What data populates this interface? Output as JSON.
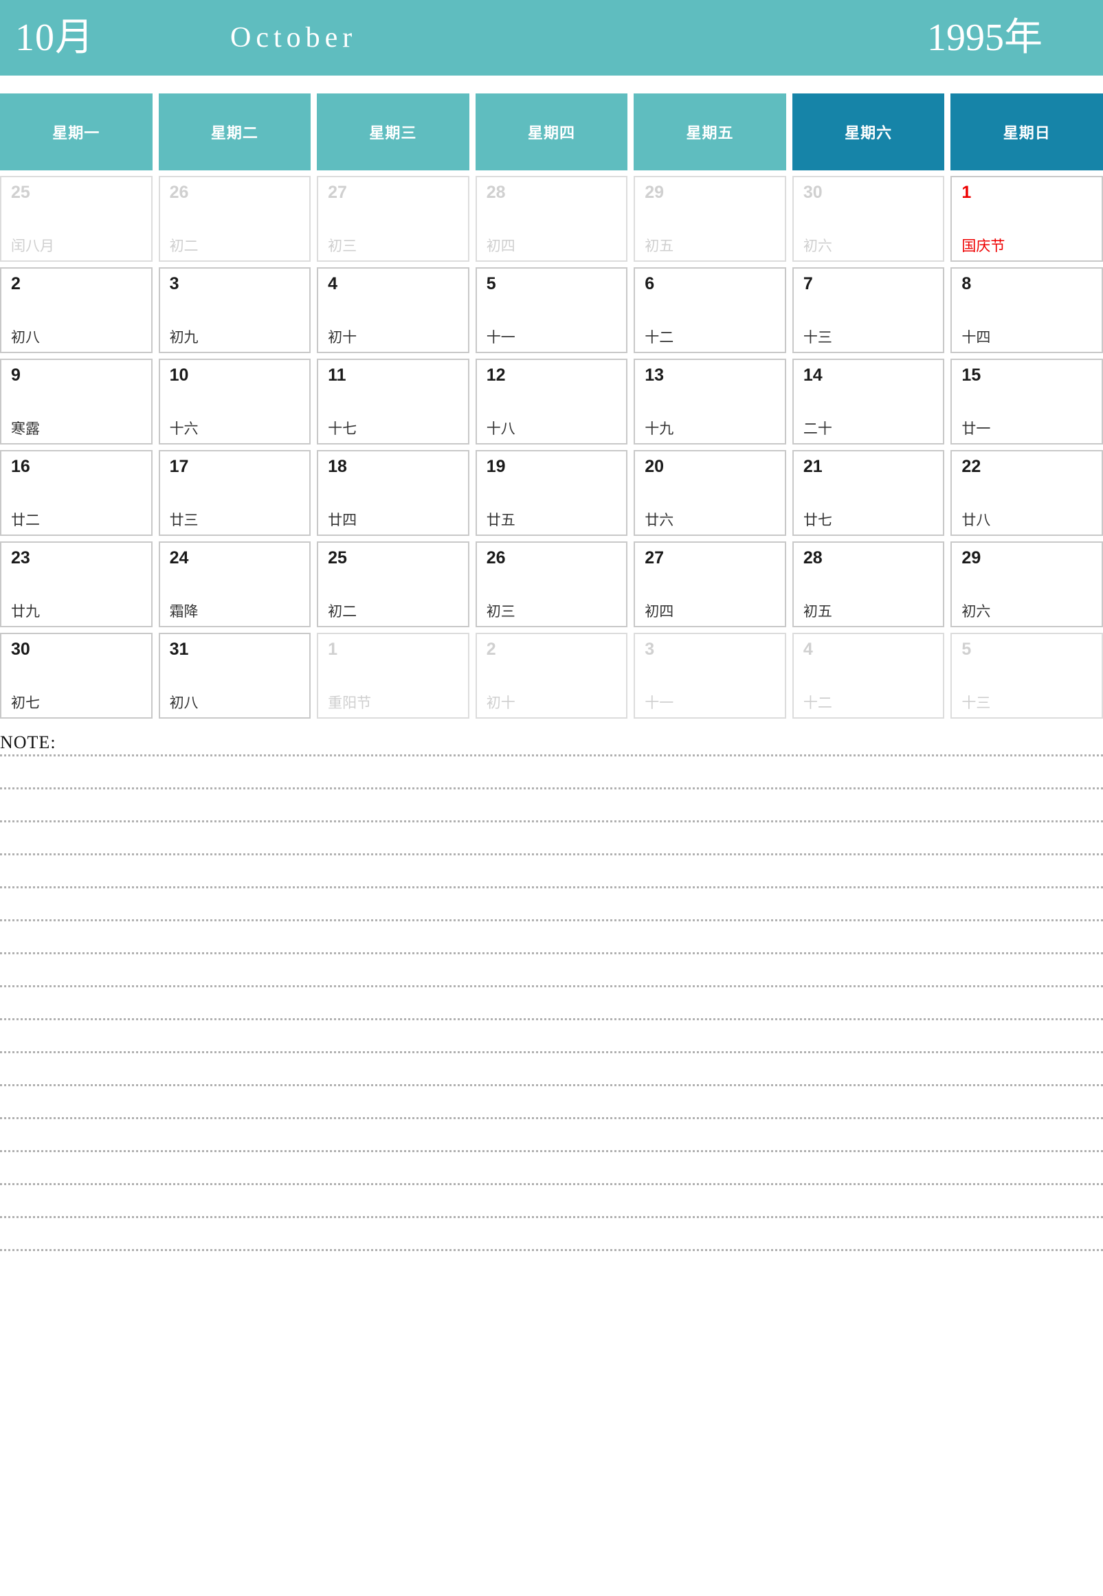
{
  "header": {
    "month_cn": "10月",
    "month_en": "October",
    "year": "1995年",
    "bg_color": "#5fbdbf",
    "text_color": "#ffffff"
  },
  "colors": {
    "accent_teal": "#5fbdbf",
    "accent_blue": "#1684a8",
    "holiday_red": "#ee0000",
    "muted_gray": "#cfcfcf",
    "cell_border": "#c8c8c8"
  },
  "weekdays": [
    {
      "label": "星期一",
      "weekend": false
    },
    {
      "label": "星期二",
      "weekend": false
    },
    {
      "label": "星期三",
      "weekend": false
    },
    {
      "label": "星期四",
      "weekend": false
    },
    {
      "label": "星期五",
      "weekend": false
    },
    {
      "label": "星期六",
      "weekend": true
    },
    {
      "label": "星期日",
      "weekend": true
    }
  ],
  "weeks": [
    [
      {
        "num": "25",
        "lunar": "闰八月",
        "muted": true,
        "holiday": false
      },
      {
        "num": "26",
        "lunar": "初二",
        "muted": true,
        "holiday": false
      },
      {
        "num": "27",
        "lunar": "初三",
        "muted": true,
        "holiday": false
      },
      {
        "num": "28",
        "lunar": "初四",
        "muted": true,
        "holiday": false
      },
      {
        "num": "29",
        "lunar": "初五",
        "muted": true,
        "holiday": false
      },
      {
        "num": "30",
        "lunar": "初六",
        "muted": true,
        "holiday": false
      },
      {
        "num": "1",
        "lunar": "国庆节",
        "muted": false,
        "holiday": true
      }
    ],
    [
      {
        "num": "2",
        "lunar": "初八",
        "muted": false,
        "holiday": false
      },
      {
        "num": "3",
        "lunar": "初九",
        "muted": false,
        "holiday": false
      },
      {
        "num": "4",
        "lunar": "初十",
        "muted": false,
        "holiday": false
      },
      {
        "num": "5",
        "lunar": "十一",
        "muted": false,
        "holiday": false
      },
      {
        "num": "6",
        "lunar": "十二",
        "muted": false,
        "holiday": false
      },
      {
        "num": "7",
        "lunar": "十三",
        "muted": false,
        "holiday": false
      },
      {
        "num": "8",
        "lunar": "十四",
        "muted": false,
        "holiday": false
      }
    ],
    [
      {
        "num": "9",
        "lunar": "寒露",
        "muted": false,
        "holiday": false
      },
      {
        "num": "10",
        "lunar": "十六",
        "muted": false,
        "holiday": false
      },
      {
        "num": "11",
        "lunar": "十七",
        "muted": false,
        "holiday": false
      },
      {
        "num": "12",
        "lunar": "十八",
        "muted": false,
        "holiday": false
      },
      {
        "num": "13",
        "lunar": "十九",
        "muted": false,
        "holiday": false
      },
      {
        "num": "14",
        "lunar": "二十",
        "muted": false,
        "holiday": false
      },
      {
        "num": "15",
        "lunar": "廿一",
        "muted": false,
        "holiday": false
      }
    ],
    [
      {
        "num": "16",
        "lunar": "廿二",
        "muted": false,
        "holiday": false
      },
      {
        "num": "17",
        "lunar": "廿三",
        "muted": false,
        "holiday": false
      },
      {
        "num": "18",
        "lunar": "廿四",
        "muted": false,
        "holiday": false
      },
      {
        "num": "19",
        "lunar": "廿五",
        "muted": false,
        "holiday": false
      },
      {
        "num": "20",
        "lunar": "廿六",
        "muted": false,
        "holiday": false
      },
      {
        "num": "21",
        "lunar": "廿七",
        "muted": false,
        "holiday": false
      },
      {
        "num": "22",
        "lunar": "廿八",
        "muted": false,
        "holiday": false
      }
    ],
    [
      {
        "num": "23",
        "lunar": "廿九",
        "muted": false,
        "holiday": false
      },
      {
        "num": "24",
        "lunar": "霜降",
        "muted": false,
        "holiday": false
      },
      {
        "num": "25",
        "lunar": "初二",
        "muted": false,
        "holiday": false
      },
      {
        "num": "26",
        "lunar": "初三",
        "muted": false,
        "holiday": false
      },
      {
        "num": "27",
        "lunar": "初四",
        "muted": false,
        "holiday": false
      },
      {
        "num": "28",
        "lunar": "初五",
        "muted": false,
        "holiday": false
      },
      {
        "num": "29",
        "lunar": "初六",
        "muted": false,
        "holiday": false
      }
    ],
    [
      {
        "num": "30",
        "lunar": "初七",
        "muted": false,
        "holiday": false
      },
      {
        "num": "31",
        "lunar": "初八",
        "muted": false,
        "holiday": false
      },
      {
        "num": "1",
        "lunar": "重阳节",
        "muted": true,
        "holiday": false
      },
      {
        "num": "2",
        "lunar": "初十",
        "muted": true,
        "holiday": false
      },
      {
        "num": "3",
        "lunar": "十一",
        "muted": true,
        "holiday": false
      },
      {
        "num": "4",
        "lunar": "十二",
        "muted": true,
        "holiday": false
      },
      {
        "num": "5",
        "lunar": "十三",
        "muted": true,
        "holiday": false
      }
    ]
  ],
  "note": {
    "label": "NOTE:",
    "line_count": 16
  }
}
